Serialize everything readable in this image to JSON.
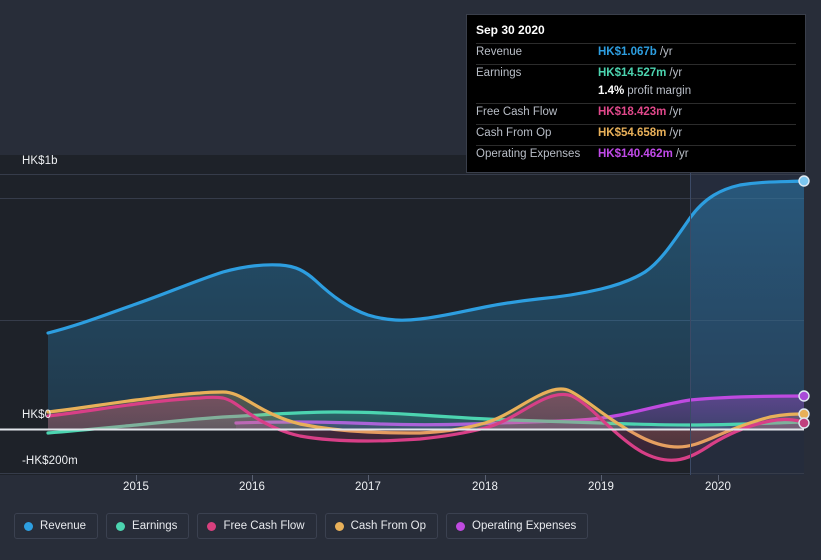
{
  "chart_data": {
    "type": "area",
    "title": "",
    "xlabel": "",
    "ylabel": "",
    "currency": "HK$",
    "grid": true,
    "legend_position": "bottom",
    "y_ticks": [
      {
        "label": "HK$1b",
        "value": 1000
      },
      {
        "label": "HK$0",
        "value": 0
      },
      {
        "label": "-HK$200m",
        "value": -200
      }
    ],
    "ylim": [
      -260,
      1100
    ],
    "x_ticks": [
      "2015",
      "2016",
      "2017",
      "2018",
      "2019",
      "2020"
    ],
    "xlim": [
      "2014-06",
      "2021-03"
    ],
    "forecast_start": "2019-09",
    "series": [
      {
        "name": "Revenue",
        "color": "#2d9ee0",
        "unit": "m",
        "x": [
          "2014-06",
          "2014-12",
          "2015-06",
          "2015-12",
          "2016-06",
          "2016-12",
          "2017-06",
          "2017-12",
          "2018-06",
          "2018-12",
          "2019-06",
          "2019-12",
          "2020-06",
          "2020-09"
        ],
        "values": [
          372,
          436,
          516,
          596,
          640,
          656,
          530,
          450,
          470,
          510,
          520,
          560,
          700,
          1067
        ]
      },
      {
        "name": "Earnings",
        "color": "#4cd4b0",
        "unit": "m",
        "x": [
          "2014-06",
          "2014-12",
          "2015-06",
          "2015-12",
          "2016-06",
          "2016-12",
          "2017-06",
          "2017-12",
          "2018-06",
          "2018-12",
          "2019-06",
          "2019-12",
          "2020-06",
          "2020-09"
        ],
        "values": [
          -26,
          -10,
          6,
          20,
          28,
          26,
          20,
          14,
          10,
          8,
          4,
          -2,
          6,
          14.527
        ]
      },
      {
        "name": "Free Cash Flow",
        "color": "#d83f87",
        "unit": "m",
        "x": [
          "2014-06",
          "2014-12",
          "2015-06",
          "2015-12",
          "2016-06",
          "2016-12",
          "2017-06",
          "2017-12",
          "2018-06",
          "2018-12",
          "2019-06",
          "2019-12",
          "2020-06",
          "2020-09"
        ],
        "values": [
          54,
          66,
          72,
          54,
          12,
          -10,
          -18,
          -14,
          22,
          66,
          10,
          -110,
          -56,
          18.423
        ]
      },
      {
        "name": "Cash From Op",
        "color": "#e8b059",
        "unit": "m",
        "x": [
          "2014-06",
          "2014-12",
          "2015-06",
          "2015-12",
          "2016-06",
          "2016-12",
          "2017-06",
          "2017-12",
          "2018-06",
          "2018-12",
          "2019-06",
          "2019-12",
          "2020-06",
          "2020-09"
        ],
        "values": [
          62,
          74,
          80,
          62,
          18,
          -4,
          -12,
          -6,
          34,
          78,
          20,
          -70,
          -22,
          54.658
        ]
      },
      {
        "name": "Operating Expenses",
        "color": "#bf4ae0",
        "unit": "m",
        "x": [
          "2014-06",
          "2014-12",
          "2015-06",
          "2015-12",
          "2016-06",
          "2016-12",
          "2017-06",
          "2017-12",
          "2018-06",
          "2018-12",
          "2019-06",
          "2019-12",
          "2020-06",
          "2020-09"
        ],
        "values": [
          null,
          null,
          null,
          20,
          18,
          14,
          10,
          8,
          12,
          16,
          38,
          82,
          128,
          140.462
        ]
      }
    ]
  },
  "tooltip": {
    "date": "Sep 30 2020",
    "rows": [
      {
        "label": "Revenue",
        "value": "HK$1.067b",
        "unit": "/yr",
        "color": "#2d9ee0"
      },
      {
        "label": "Earnings",
        "value": "HK$14.527m",
        "unit": "/yr",
        "color": "#4cd4b0"
      },
      {
        "label": "Free Cash Flow",
        "value": "HK$18.423m",
        "unit": "/yr",
        "color": "#e0488a"
      },
      {
        "label": "Cash From Op",
        "value": "HK$54.658m",
        "unit": "/yr",
        "color": "#e8b059"
      },
      {
        "label": "Operating Expenses",
        "value": "HK$140.462m",
        "unit": "/yr",
        "color": "#c04ae8"
      }
    ],
    "profit_margin_value": "1.4%",
    "profit_margin_text": "profit margin"
  },
  "axis": {
    "y_labels": [
      "HK$1b",
      "HK$0",
      "-HK$200m"
    ],
    "x_labels": [
      "2015",
      "2016",
      "2017",
      "2018",
      "2019",
      "2020"
    ]
  },
  "legend": {
    "items": [
      {
        "label": "Revenue",
        "color": "#2d9ee0"
      },
      {
        "label": "Earnings",
        "color": "#4cd4b0"
      },
      {
        "label": "Free Cash Flow",
        "color": "#d8407e"
      },
      {
        "label": "Cash From Op",
        "color": "#e8b059"
      },
      {
        "label": "Operating Expenses",
        "color": "#bf4ae0"
      }
    ]
  },
  "colors": {
    "background": "#282d39",
    "plot_background": "#1e2229",
    "forecast_background": "#232a3a",
    "gridline": "#343a47",
    "zero_line": "#d8dce3"
  }
}
